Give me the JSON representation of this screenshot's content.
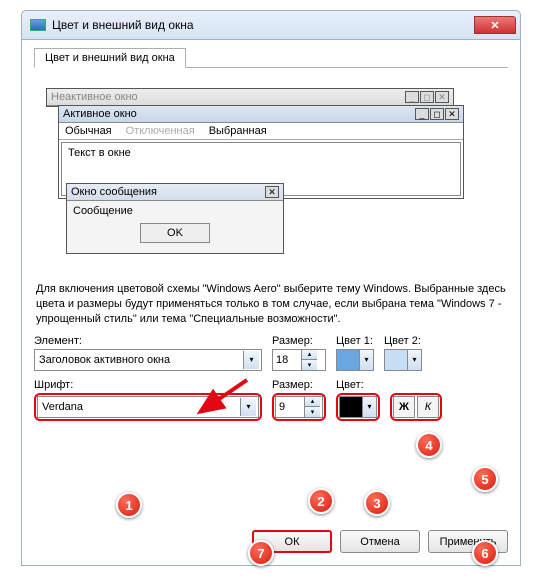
{
  "window": {
    "title": "Цвет и внешний вид окна"
  },
  "tab": {
    "label": "Цвет и внешний вид окна"
  },
  "preview": {
    "inactive_title": "Неактивное окно",
    "active_title": "Активное окно",
    "menu_normal": "Обычная",
    "menu_disabled": "Отключенная",
    "menu_selected": "Выбранная",
    "text_in_window": "Текст в окне",
    "msg_title": "Окно сообщения",
    "msg_body": "Сообщение",
    "msg_ok": "OK"
  },
  "description": "Для включения цветовой схемы \"Windows Aero\" выберите тему Windows. Выбранные здесь цвета и размеры будут применяться только в том случае, если выбрана тема \"Windows 7 - упрощенный стиль\" или тема \"Специальные возможности\".",
  "labels": {
    "element": "Элемент:",
    "size1": "Размер:",
    "color1": "Цвет 1:",
    "color2": "Цвет 2:",
    "font": "Шрифт:",
    "size2": "Размер:",
    "color": "Цвет:"
  },
  "values": {
    "element": "Заголовок активного окна",
    "size1": "18",
    "font": "Verdana",
    "size2": "9",
    "bold": "Ж",
    "italic": "К"
  },
  "colors": {
    "c1": "#6aa6e0",
    "c2": "#c7dff5",
    "font_color": "#000000"
  },
  "buttons": {
    "ok": "ОК",
    "cancel": "Отмена",
    "apply": "Применить"
  },
  "badges": [
    "1",
    "2",
    "3",
    "4",
    "5",
    "6",
    "7"
  ]
}
